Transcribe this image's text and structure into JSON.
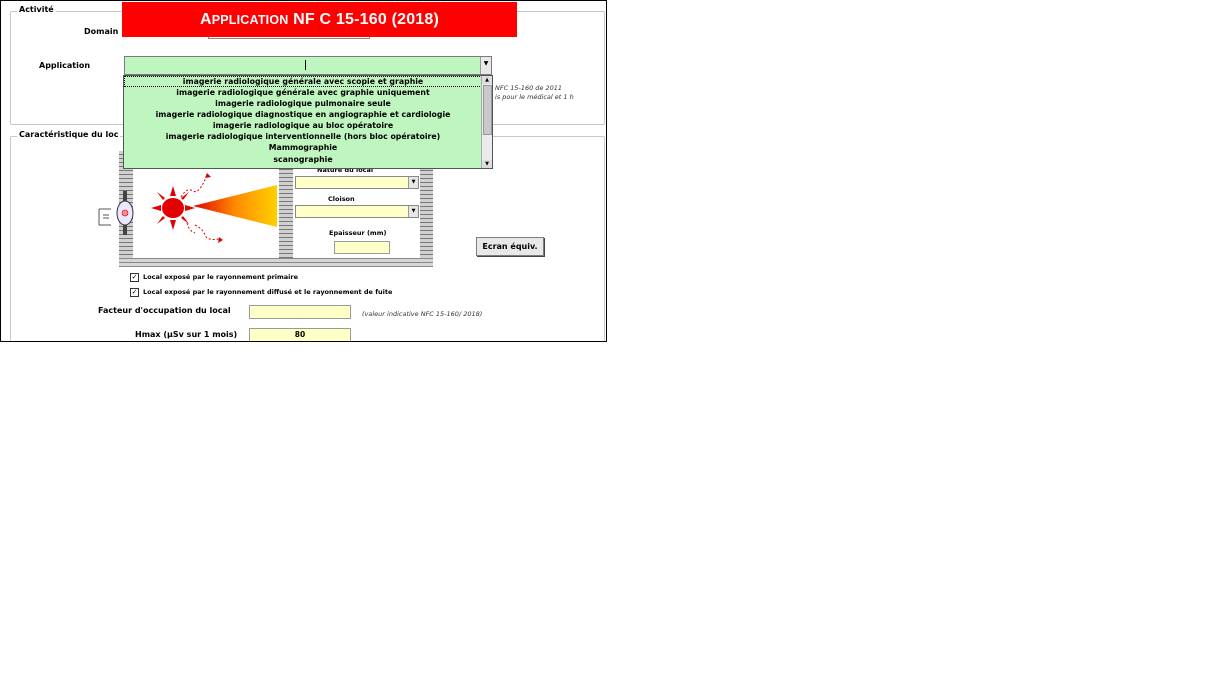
{
  "banner": {
    "first_letter": "A",
    "rest": "PPLICATION",
    "suffix": " NF C 15-160 (2018)"
  },
  "activite": {
    "legend": "Activité",
    "domaine_label": "Domain",
    "application_label": "Application",
    "application_value": "",
    "note_line1": "NFC 15-160 de 2011",
    "note_line2": "is pour le médical et 1 h"
  },
  "dropdown": {
    "items": [
      "imagerie radiologique générale avec scopie et graphie",
      "imagerie radiologique générale avec graphie uniquement",
      "imagerie radiologique pulmonaire seule",
      "imagerie radiologique diagnostique en angiographie et cardiologie",
      "imagerie radiologique au bloc opératoire",
      "imagerie radiologique interventionnelle (hors bloc opératoire)",
      "Mammographie",
      "scanographie"
    ]
  },
  "local": {
    "legend": "Caractéristique du loc",
    "nature_label": "Nature du local",
    "nature_value": "",
    "cloison_label": "Cloison",
    "cloison_value": "",
    "epaisseur_label": "Epaisseur (mm)",
    "epaisseur_value": "",
    "ecran_button": "Ecran équiv.",
    "cb_primary": "Local exposé par le rayonnement primaire",
    "cb_diffuse": "Local exposé par le rayonnement diffusé et le rayonnement de fuite",
    "cb_checkmark": "✓",
    "facteur_label": "Facteur d'occupation du local",
    "facteur_value": "",
    "facteur_note": "(valeur indicative NFC 15-160/ 2018)",
    "hmax_label": "Hmax (µSv sur 1 mois)",
    "hmax_value": "80"
  },
  "icons": {
    "combo_arrow": "▼",
    "scroll_up": "▲",
    "scroll_down": "▼"
  },
  "colors": {
    "banner": "#ff0000",
    "combo_green": "#bff5bf",
    "input_yellow": "#ffffc8"
  }
}
